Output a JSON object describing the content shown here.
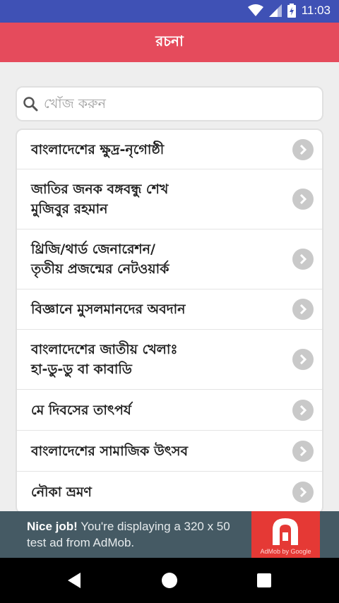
{
  "status_bar": {
    "time": "11:03"
  },
  "app_bar": {
    "title": "রচনা"
  },
  "search": {
    "placeholder": "খোঁজ করুন",
    "value": ""
  },
  "essays": [
    {
      "title": "বাংলাদেশের ক্ষুদ্র-নৃগোষ্ঠী"
    },
    {
      "title": "জাতির জনক বঙ্গবন্ধু শেখ\nমুজিবুর রহমান"
    },
    {
      "title": "থ্রিজি/থার্ড জেনারেশন/\nতৃতীয় প্রজন্মের নেটওয়ার্ক"
    },
    {
      "title": "বিজ্ঞানে মুসলমানদের অবদান"
    },
    {
      "title": "বাংলাদেশের জাতীয় খেলাঃ\nহা-ডু-ডু বা কাবাডি"
    },
    {
      "title": "মে দিবসের তাৎপর্য"
    },
    {
      "title": "বাংলাদেশের সামাজিক উৎসব"
    },
    {
      "title": "নৌকা ভ্রমণ"
    }
  ],
  "ad": {
    "headline": "Nice job!",
    "body": "You're displaying a 320 x 50 test ad from AdMob.",
    "logo_caption": "AdMob by Google"
  },
  "colors": {
    "status_bar": "#3f51b5",
    "app_bar": "#e54b5c",
    "ad_background": "#455a64",
    "ad_logo": "#e53935"
  },
  "icons": [
    "wifi-icon",
    "signal-icon",
    "battery-icon",
    "search-icon",
    "chevron-right-icon",
    "admob-logo-icon",
    "back-icon",
    "home-icon",
    "recents-icon"
  ]
}
